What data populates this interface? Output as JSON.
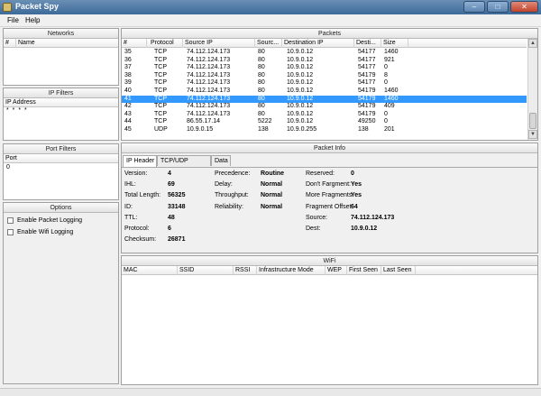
{
  "window": {
    "title": "Packet Spy",
    "minimize": "–",
    "maximize": "□",
    "close": "✕"
  },
  "menu": [
    "File",
    "Help"
  ],
  "networks": {
    "title": "Networks",
    "columns": [
      "#",
      "Name"
    ]
  },
  "ip_filters": {
    "title": "IP Filters",
    "column": "IP Address",
    "entry": "* * * *"
  },
  "port_filters": {
    "title": "Port Filters",
    "column": "Port",
    "value": "0"
  },
  "options": {
    "title": "Options",
    "items": [
      "Enable Packet Logging",
      "Enable Wifi Logging"
    ]
  },
  "packets": {
    "title": "Packets",
    "columns": [
      "#",
      "Protocol",
      "Source IP",
      "Sourc...",
      "Destination IP",
      "Desti...",
      "Size"
    ],
    "rows": [
      [
        "35",
        "TCP",
        "74.112.124.173",
        "80",
        "10.9.0.12",
        "54177",
        "1460"
      ],
      [
        "36",
        "TCP",
        "74.112.124.173",
        "80",
        "10.9.0.12",
        "54177",
        "921"
      ],
      [
        "37",
        "TCP",
        "74.112.124.173",
        "80",
        "10.9.0.12",
        "54177",
        "0"
      ],
      [
        "38",
        "TCP",
        "74.112.124.173",
        "80",
        "10.9.0.12",
        "54179",
        "8"
      ],
      [
        "39",
        "TCP",
        "74.112.124.173",
        "80",
        "10.9.0.12",
        "54177",
        "0"
      ],
      [
        "40",
        "TCP",
        "74.112.124.173",
        "80",
        "10.9.0.12",
        "54179",
        "1460"
      ],
      [
        "41",
        "TCP",
        "74.112.124.173",
        "80",
        "10.9.0.12",
        "54179",
        "1460"
      ],
      [
        "42",
        "TCP",
        "74.112.124.173",
        "80",
        "10.9.0.12",
        "54179",
        "409"
      ],
      [
        "43",
        "TCP",
        "74.112.124.173",
        "80",
        "10.9.0.12",
        "54179",
        "0"
      ],
      [
        "44",
        "TCP",
        "86.55.17.14",
        "5222",
        "10.9.0.12",
        "49250",
        "0"
      ],
      [
        "45",
        "UDP",
        "10.9.0.15",
        "138",
        "10.9.0.255",
        "138",
        "201"
      ]
    ],
    "selected_row": 6
  },
  "packet_info": {
    "title": "Packet Info",
    "tabs": [
      "IP Header",
      "TCP/UDP Header",
      "Data"
    ],
    "col1": [
      [
        "Version:",
        "4"
      ],
      [
        "IHL:",
        "69"
      ],
      [
        "Total Length:",
        "56325"
      ],
      [
        "ID:",
        "33148"
      ],
      [
        "TTL:",
        "48"
      ],
      [
        "Protocol:",
        "6"
      ],
      [
        "Checksum:",
        "26871"
      ]
    ],
    "col2": [
      [
        "Precedence:",
        "Routine"
      ],
      [
        "Delay:",
        "Normal"
      ],
      [
        "Throughput:",
        "Normal"
      ],
      [
        "Reliability:",
        "Normal"
      ]
    ],
    "col3": [
      [
        "Reserved:",
        "0"
      ],
      [
        "Don't Fargment:",
        "Yes"
      ],
      [
        "More Fragments",
        "Yes"
      ],
      [
        "Fragment Offset",
        "64"
      ],
      [
        "Source:",
        "74.112.124.173"
      ],
      [
        "Dest:",
        "10.9.0.12"
      ]
    ]
  },
  "wifi": {
    "title": "WiFi",
    "columns": [
      "MAC",
      "SSID",
      "RSSI",
      "Infrastructure Mode",
      "WEP",
      "First Seen",
      "Last Seen"
    ]
  },
  "colors": {
    "selection": "#3399ff",
    "titlebar": "#4a76a5"
  }
}
